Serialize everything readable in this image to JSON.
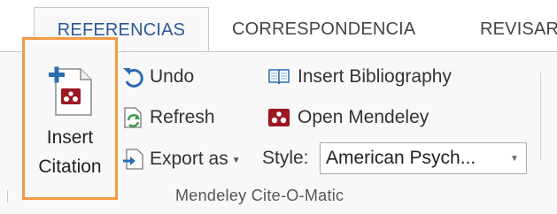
{
  "tabs": [
    {
      "label": "REFERENCIAS",
      "active": true
    },
    {
      "label": "CORRESPONDENCIA",
      "active": false
    },
    {
      "label": "REVISAR",
      "active": false
    }
  ],
  "insert_citation": {
    "line1": "Insert",
    "line2": "Citation",
    "highlight_color": "#f39a45"
  },
  "commands": {
    "undo": {
      "label": "Undo",
      "icon": "undo-icon"
    },
    "refresh": {
      "label": "Refresh",
      "icon": "refresh-icon"
    },
    "export_as": {
      "label": "Export as",
      "icon": "export-icon"
    },
    "insert_bibliography": {
      "label": "Insert Bibliography",
      "icon": "bibliography-icon"
    },
    "open_mendeley": {
      "label": "Open Mendeley",
      "icon": "mendeley-icon"
    }
  },
  "style": {
    "label": "Style:",
    "value": "American Psych..."
  },
  "group_label": "Mendeley Cite-O-Matic",
  "colors": {
    "accent_blue": "#2b579a",
    "mendeley_red": "#9d1620",
    "highlight_orange": "#f39a45"
  }
}
